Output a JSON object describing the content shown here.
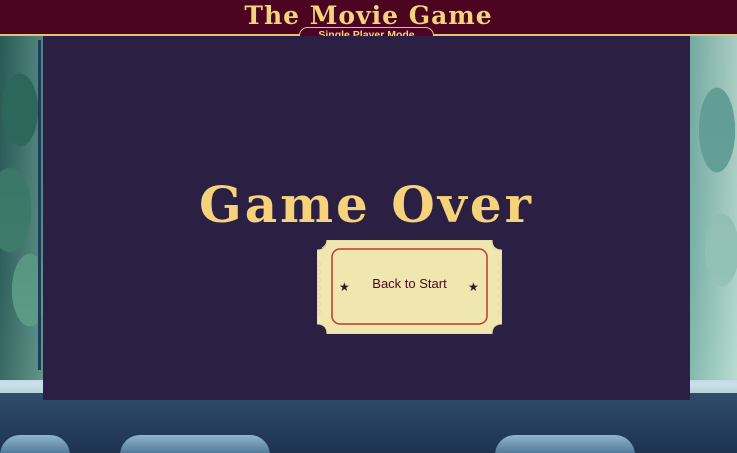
{
  "header": {
    "title": "The Movie Game",
    "mode": "Single Player Mode"
  },
  "main": {
    "status": "Game Over",
    "back_button_label": "Back to Start"
  },
  "colors": {
    "header_bg": "#4b0521",
    "gold": "#f5d27c",
    "panel_bg": "#2c1f44",
    "ticket_bg": "#efe6b0",
    "ticket_border": "#c0392b"
  },
  "icons": {
    "left_star": "star-icon",
    "right_star": "star-icon"
  }
}
